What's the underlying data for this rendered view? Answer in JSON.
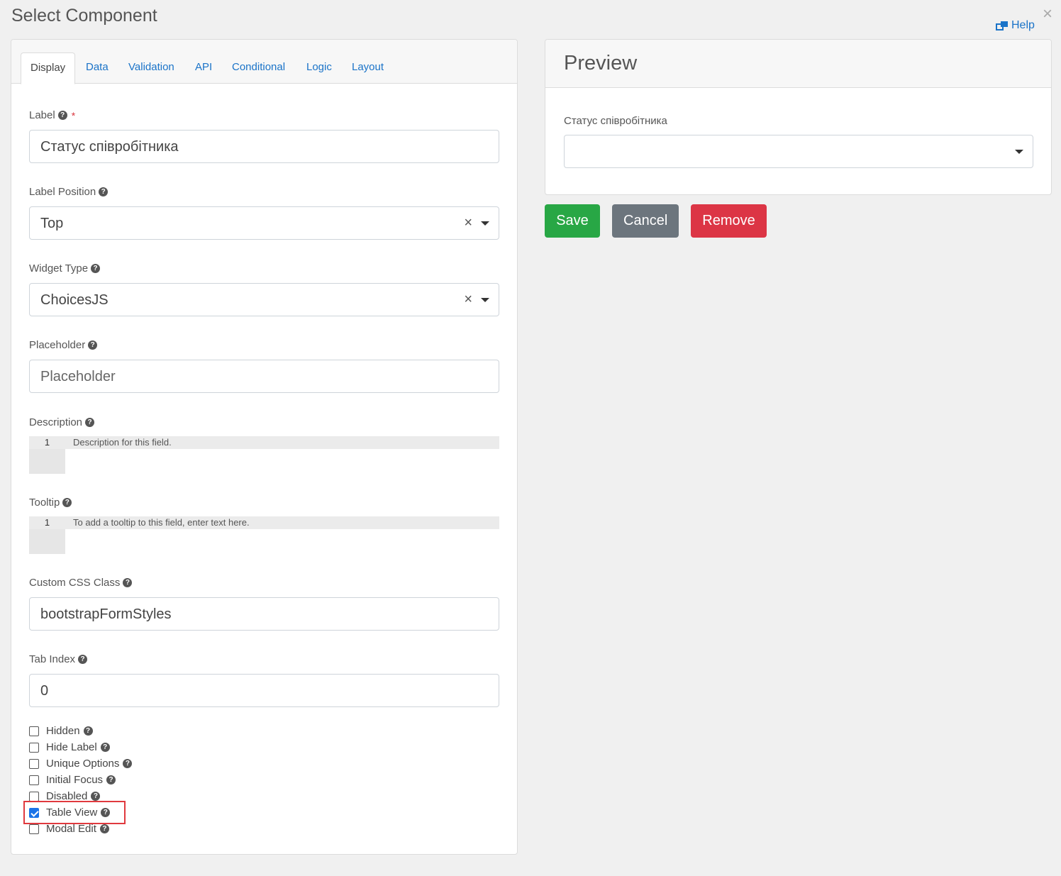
{
  "modal": {
    "title": "Select Component",
    "help_label": "Help",
    "close_glyph": "×"
  },
  "tabs": [
    {
      "label": "Display",
      "active": true
    },
    {
      "label": "Data"
    },
    {
      "label": "Validation"
    },
    {
      "label": "API"
    },
    {
      "label": "Conditional"
    },
    {
      "label": "Logic"
    },
    {
      "label": "Layout"
    }
  ],
  "form": {
    "label": {
      "title": "Label",
      "required_mark": "*",
      "value": "Статус співробітника"
    },
    "label_position": {
      "title": "Label Position",
      "value": "Top"
    },
    "widget_type": {
      "title": "Widget Type",
      "value": "ChoicesJS"
    },
    "placeholder": {
      "title": "Placeholder",
      "placeholder": "Placeholder"
    },
    "description": {
      "title": "Description",
      "line_number": "1",
      "placeholder": "Description for this field."
    },
    "tooltip": {
      "title": "Tooltip",
      "line_number": "1",
      "placeholder": "To add a tooltip to this field, enter text here."
    },
    "custom_css": {
      "title": "Custom CSS Class",
      "value": "bootstrapFormStyles"
    },
    "tab_index": {
      "title": "Tab Index",
      "value": "0"
    },
    "clear_glyph": "×",
    "help_glyph": "?"
  },
  "checkboxes": [
    {
      "label": "Hidden",
      "checked": false
    },
    {
      "label": "Hide Label",
      "checked": false
    },
    {
      "label": "Unique Options",
      "checked": false
    },
    {
      "label": "Initial Focus",
      "checked": false
    },
    {
      "label": "Disabled",
      "checked": false
    },
    {
      "label": "Table View",
      "checked": true
    },
    {
      "label": "Modal Edit",
      "checked": false
    }
  ],
  "preview": {
    "title": "Preview",
    "field_label": "Статус співробітника"
  },
  "buttons": {
    "save": "Save",
    "cancel": "Cancel",
    "remove": "Remove"
  },
  "colors": {
    "link": "#1a73c8",
    "save": "#28a745",
    "cancel": "#6c757d",
    "remove": "#dc3545",
    "highlight": "#e0393e"
  }
}
